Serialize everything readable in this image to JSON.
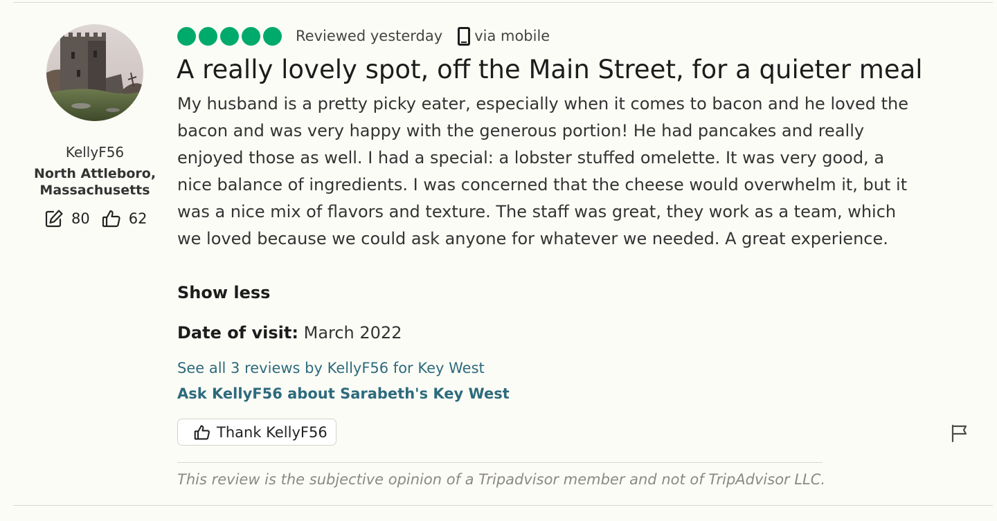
{
  "reviewer": {
    "username": "KellyF56",
    "location": "North Attleboro, Massachusetts",
    "contributions": "80",
    "helpful_votes": "62",
    "avatar_icon": "castle-photo-avatar"
  },
  "review": {
    "rating": 5,
    "rating_max": 5,
    "rating_color": "#00aa6c",
    "reviewed_when": "Reviewed yesterday",
    "device_label": "via mobile",
    "title": "A really lovely spot, off the Main Street, for a quieter meal",
    "body": "My husband is a pretty picky eater, especially when it comes to bacon and he loved the bacon and was very happy with the generous portion! He had pancakes and really enjoyed those as well. I had a special: a lobster stuffed omelette. It was very good, a nice balance of ingredients. I was concerned that the cheese would overwhelm it, but it was a nice mix of flavors and texture. The staff was great, they work as a team, which we loved because we could ask anyone for whatever we needed. A great experience.",
    "show_less_label": "Show less",
    "date_of_visit_label": "Date of visit:",
    "date_of_visit": "March 2022"
  },
  "links": {
    "see_all": "See all 3 reviews by KellyF56 for Key West",
    "ask": "Ask KellyF56 about Sarabeth's Key West",
    "color": "#2d6a7d"
  },
  "actions": {
    "thank_label": "Thank KellyF56",
    "report_icon": "flag-icon"
  },
  "disclaimer": "This review is the subjective opinion of a Tripadvisor member and not of TripAdvisor LLC."
}
